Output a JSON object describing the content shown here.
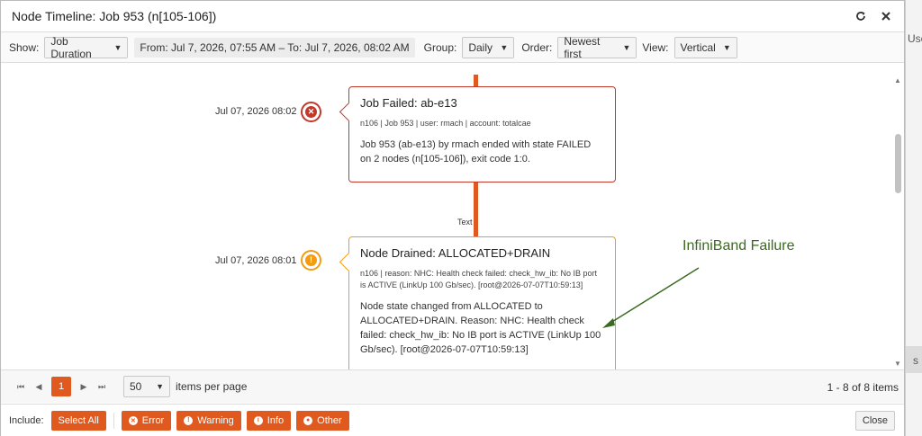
{
  "background": {
    "fragment_top": "Use",
    "fragment_bottom": "s"
  },
  "window": {
    "title": "Node Timeline: Job 953 (n[105-106])"
  },
  "toolbar": {
    "show_label": "Show:",
    "show_value": "Job Duration",
    "date_range": "From: Jul 7, 2026, 07:55 AM – To: Jul 7, 2026, 08:02 AM",
    "group_label": "Group:",
    "group_value": "Daily",
    "order_label": "Order:",
    "order_value": "Newest first",
    "view_label": "View:",
    "view_value": "Vertical"
  },
  "timeline": {
    "connector_label": "Text",
    "events": [
      {
        "timestamp": "Jul 07, 2026 08:02",
        "type": "error",
        "icon": "x-circle-icon",
        "color": "#c0392b",
        "title": "Job Failed: ab-e13",
        "meta": "n106 | Job 953 | user: rmach | account: totalcae",
        "body": "Job 953 (ab-e13) by rmach ended with state FAILED on 2 nodes (n[105-106]), exit code 1:0."
      },
      {
        "timestamp": "Jul 07, 2026 08:01",
        "type": "warning",
        "icon": "exclamation-circle-icon",
        "color": "#f39c12",
        "title": "Node Drained: ALLOCATED+DRAIN",
        "meta": "n106 | reason: NHC: Health check failed: check_hw_ib: No IB port is ACTIVE (LinkUp 100 Gb/sec). [root@2026-07-07T10:59:13]",
        "body": "Node state changed from ALLOCATED to ALLOCATED+DRAIN. Reason: NHC: Health check failed: check_hw_ib: No IB port is ACTIVE (LinkUp 100 Gb/sec). [root@2026-07-07T10:59:13]"
      }
    ],
    "annotation": "InfiniBand Failure"
  },
  "pager": {
    "current_page": "1",
    "page_size": "50",
    "items_per_page_label": "items per page",
    "count_text": "1 - 8 of 8 items"
  },
  "footer": {
    "include_label": "Include:",
    "select_all": "Select All",
    "error": "Error",
    "warning": "Warning",
    "info": "Info",
    "other": "Other",
    "close": "Close"
  },
  "colors": {
    "accent": "#e05a1f",
    "error": "#c0392b",
    "warning": "#f39c12",
    "annotation": "#3a6a1f"
  }
}
